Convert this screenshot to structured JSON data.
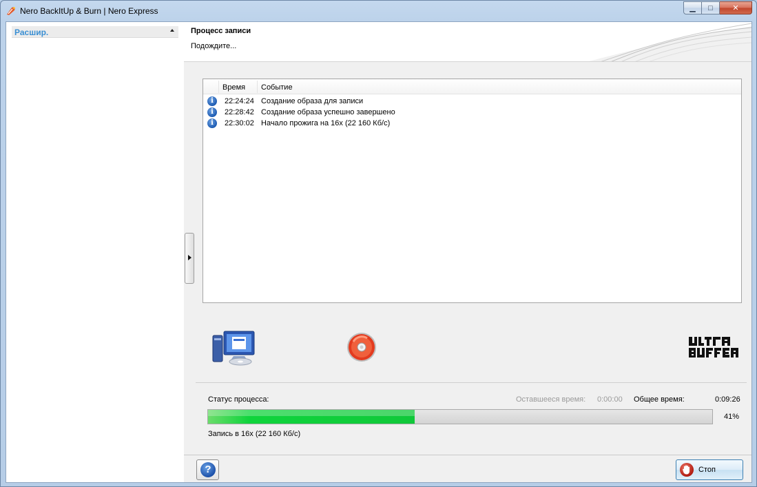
{
  "window": {
    "title": "Nero BackItUp & Burn | Nero Express",
    "minimize_glyph": "▁",
    "maximize_glyph": "□",
    "close_glyph": "✕"
  },
  "sidebar": {
    "header_label": "Расшир."
  },
  "header": {
    "title": "Процесс записи",
    "subtitle": "Подождите..."
  },
  "log": {
    "columns": {
      "time": "Время",
      "event": "Событие"
    },
    "rows": [
      {
        "time": "22:24:24",
        "event": "Создание образа для записи",
        "icon": "info-icon"
      },
      {
        "time": "22:28:42",
        "event": "Создание образа успешно завершено",
        "icon": "info-icon"
      },
      {
        "time": "22:30:02",
        "event": "Начало прожига на 16x (22 160 Кб/с)",
        "icon": "info-icon"
      }
    ]
  },
  "status": {
    "label": "Статус процесса:",
    "remaining_label": "Оставшееся время:",
    "remaining_value": "0:00:00",
    "total_label": "Общее время:",
    "total_value": "0:09:26",
    "progress_percent": 41,
    "progress_text": "41%",
    "write_status": "Запись в 16x (22 160 Кб/с)"
  },
  "footer": {
    "help_glyph": "?",
    "stop_label": "Стоп"
  },
  "colors": {
    "accent": "#3a8fd3",
    "progress_fill": "#10c83a"
  }
}
